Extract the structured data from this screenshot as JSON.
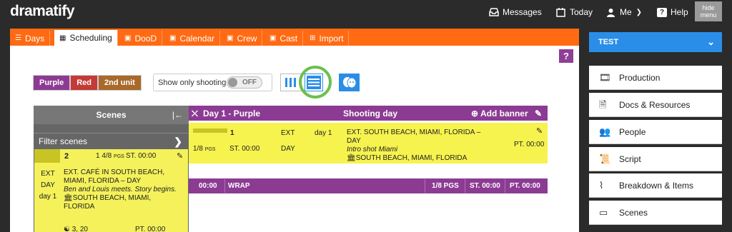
{
  "topbar": {
    "logo": "dramatify",
    "messages": "Messages",
    "today": "Today",
    "me": "Me",
    "help": "Help",
    "hide_menu_1": "hide",
    "hide_menu_2": "menu"
  },
  "tabs": [
    {
      "label": "Days",
      "icon": "list-icon"
    },
    {
      "label": "Scheduling",
      "icon": "grid-icon",
      "active": true
    },
    {
      "label": "DooD",
      "icon": "calendar-icon"
    },
    {
      "label": "Calendar",
      "icon": "calendar-icon"
    },
    {
      "label": "Crew",
      "icon": "calendar-icon"
    },
    {
      "label": "Cast",
      "icon": "calendar-icon"
    },
    {
      "label": "Import",
      "icon": "plus-square-icon"
    }
  ],
  "help_button": "?",
  "filters": {
    "buttons": [
      {
        "label": "Purple",
        "color": "#8c3b93"
      },
      {
        "label": "Red",
        "color": "#c43a36"
      },
      {
        "label": "2nd unit",
        "color": "#a8692a"
      }
    ],
    "show_only_shooting": "Show only shooting",
    "toggle_state": "OFF"
  },
  "scenes_panel": {
    "title": "Scenes",
    "collapse": "|←",
    "filter_label": "Filter scenes",
    "card": {
      "number": "2",
      "pages": "1 4/8",
      "pages_unit": "PGS",
      "start_time": "ST. 00:00",
      "int_ext": "EXT",
      "time_of_day": "DAY",
      "day": "day 1",
      "heading": "EXT. CAFÉ IN SOUTH BEACH, MIAMI, FLORIDA – DAY",
      "synopsis": "Ben and Louis meets. Story begins.",
      "location": "SOUTH BEACH, MIAMI, FLORIDA",
      "cast": "3, 20",
      "pt": "PT. 00:00"
    }
  },
  "day": {
    "title": "Day 1 - Purple",
    "label": "Shooting day",
    "add_banner": "Add banner",
    "scene": {
      "number": "1",
      "int_ext": "EXT",
      "day": "day 1",
      "pages": "1/8",
      "pages_unit": "PGS",
      "start_time": "ST. 00:00",
      "time_of_day": "DAY",
      "heading": "EXT. SOUTH BEACH, MIAMI, FLORIDA – DAY",
      "synopsis": "Intro shot Miami",
      "location": "SOUTH BEACH, MIAMI, FLORIDA",
      "pt": "PT. 00:00"
    },
    "wrap": {
      "time": "00:00",
      "label": "WRAP",
      "pages": "1/8 PGS",
      "start": "ST. 00:00",
      "pt": "PT. 00:00"
    }
  },
  "sidebar": {
    "project": "TEST",
    "items": [
      {
        "label": "Production",
        "icon": "film-icon"
      },
      {
        "label": "Docs & Resources",
        "icon": "document-icon"
      },
      {
        "label": "People",
        "icon": "people-icon"
      },
      {
        "label": "Script",
        "icon": "script-icon"
      },
      {
        "label": "Breakdown & Items",
        "icon": "breakdown-icon"
      },
      {
        "label": "Scenes",
        "icon": "scenes-icon"
      }
    ]
  },
  "colors": {
    "accent_orange": "#ff6a13",
    "purple": "#8c3b93",
    "yellow": "#f6f34e",
    "sidebar_blue": "#2a8ee8",
    "highlight_ring": "#6cc04a"
  }
}
